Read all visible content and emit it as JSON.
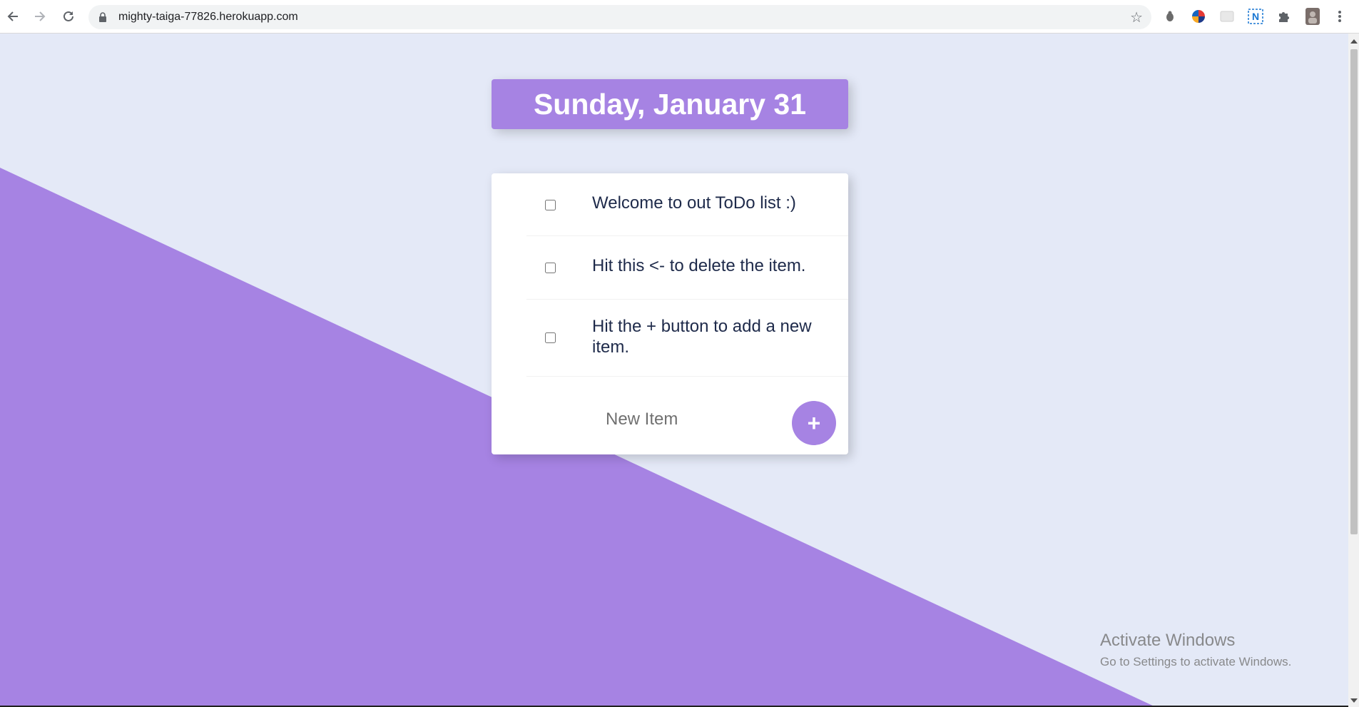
{
  "browser": {
    "url": "mighty-taiga-77826.herokuapp.com",
    "icons": {
      "back": "back-arrow-icon",
      "forward": "forward-arrow-icon",
      "reload": "reload-icon",
      "lock": "lock-icon",
      "bookmark": "star-icon",
      "extensions": [
        "bug-icon",
        "colorful-globe-icon",
        "blank-extension-icon",
        "n-extension-icon",
        "puzzle-icon",
        "profile-avatar",
        "kebab-menu-icon"
      ]
    }
  },
  "page": {
    "date_heading": "Sunday, January 31",
    "items": [
      {
        "text": "Welcome to out ToDo list :)",
        "checked": false
      },
      {
        "text": "Hit this <- to delete the item.",
        "checked": false
      },
      {
        "text": "Hit the + button to add a new item.",
        "checked": false
      }
    ],
    "new_item_placeholder": "New Item",
    "add_button_label": "+"
  },
  "watermark": {
    "title": "Activate Windows",
    "subtitle": "Go to Settings to activate Windows."
  },
  "colors": {
    "accent": "#A683E3",
    "background": "#E4E9F7",
    "card": "#FFFFFF",
    "item_text": "#1E2A4A"
  }
}
